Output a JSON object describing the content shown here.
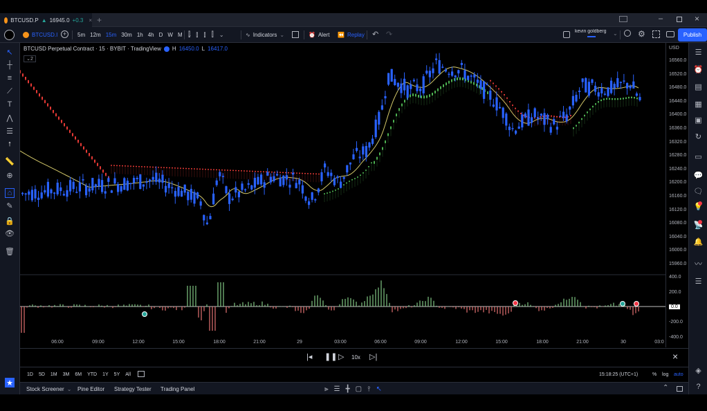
{
  "tab": {
    "symbol": "BTCUSD.P",
    "price": "16945.0",
    "change": "+0.3"
  },
  "toolbar": {
    "symbol": "BTCUSD.I",
    "intervals": [
      "5m",
      "12m",
      "15m",
      "30m",
      "1h",
      "4h",
      "D",
      "W",
      "M"
    ],
    "active_interval": "15m",
    "indicators_label": "Indicators",
    "alert_label": "Alert",
    "replay_label": "Replay",
    "user_name": "kevin goldberg",
    "publish_label": "Publish"
  },
  "legend": {
    "title": "BTCUSD Perpetual Contract · 15 · BYBIT · TradingView",
    "h_label": "H",
    "h_value": "16450.0",
    "l_label": "L",
    "l_value": "16417.0",
    "collapse_count": "2"
  },
  "price_axis": {
    "currency": "USD",
    "ticks": [
      "16560.0",
      "16520.0",
      "16480.0",
      "16440.0",
      "16400.0",
      "16360.0",
      "16320.0",
      "16280.0",
      "16240.0",
      "16200.0",
      "16160.0",
      "16120.0",
      "16080.0",
      "16040.0",
      "16000.0",
      "15960.0"
    ],
    "osc_ticks": [
      "400.0",
      "200.0",
      "0.0",
      "-200.0",
      "-400.0"
    ]
  },
  "time_axis": {
    "labels": [
      "06:00",
      "09:00",
      "12:00",
      "15:00",
      "18:00",
      "21:00",
      "29",
      "03:00",
      "06:00",
      "09:00",
      "12:00",
      "15:00",
      "18:00",
      "21:00",
      "30",
      "03:0"
    ]
  },
  "replay": {
    "speed": "10x"
  },
  "range": {
    "buttons": [
      "1D",
      "5D",
      "1M",
      "3M",
      "6M",
      "YTD",
      "1Y",
      "5Y",
      "All"
    ],
    "time": "15:18:25 (UTC+1)",
    "percent": "%",
    "log": "log",
    "auto": "auto"
  },
  "bottom": {
    "tabs": [
      "Stock Screener",
      "Pine Editor",
      "Strategy Tester",
      "Trading Panel"
    ]
  },
  "colors": {
    "candle": "#2962ff",
    "bear_trail": "#e53935",
    "bull_trail": "#4caf50",
    "ma": "#d4c96a",
    "osc_up": "#81c784",
    "osc_down": "#e57373"
  }
}
